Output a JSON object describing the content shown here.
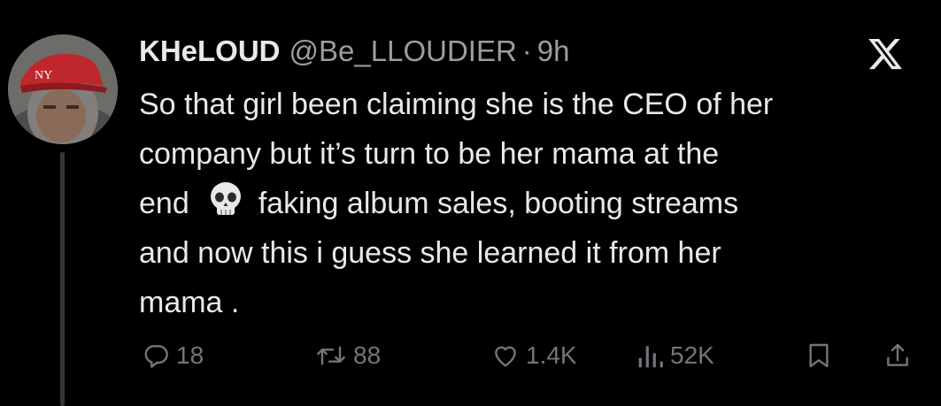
{
  "tweet": {
    "display_name": "KHeLOUD",
    "handle": "@Be_LLOUDIER",
    "separator": "·",
    "time": "9h",
    "text_line_1": "So that girl been claiming she is the CEO of her",
    "text_line_2": "company but it’s turn to be her mama at the",
    "text_line_3a": "end",
    "text_line_3b": "faking album sales, booting streams",
    "text_line_4": "and now this i guess she learned it from her",
    "text_line_5": "mama ."
  },
  "emoji": {
    "inline": "skull-emoji"
  },
  "header_icon": "x-logo-icon",
  "avatar_icon": "profile-avatar",
  "actions": {
    "reply": {
      "icon": "reply-icon",
      "count": "18"
    },
    "retweet": {
      "icon": "retweet-icon",
      "count": "88"
    },
    "like": {
      "icon": "heart-icon",
      "count": "1.4K"
    },
    "views": {
      "icon": "views-icon",
      "count": "52K"
    },
    "bookmark": {
      "icon": "bookmark-icon"
    },
    "share": {
      "icon": "share-icon"
    }
  },
  "colors": {
    "background": "#000000",
    "primary_text": "#e7e9ea",
    "secondary_text": "#71767b",
    "thread_line": "#333639"
  }
}
